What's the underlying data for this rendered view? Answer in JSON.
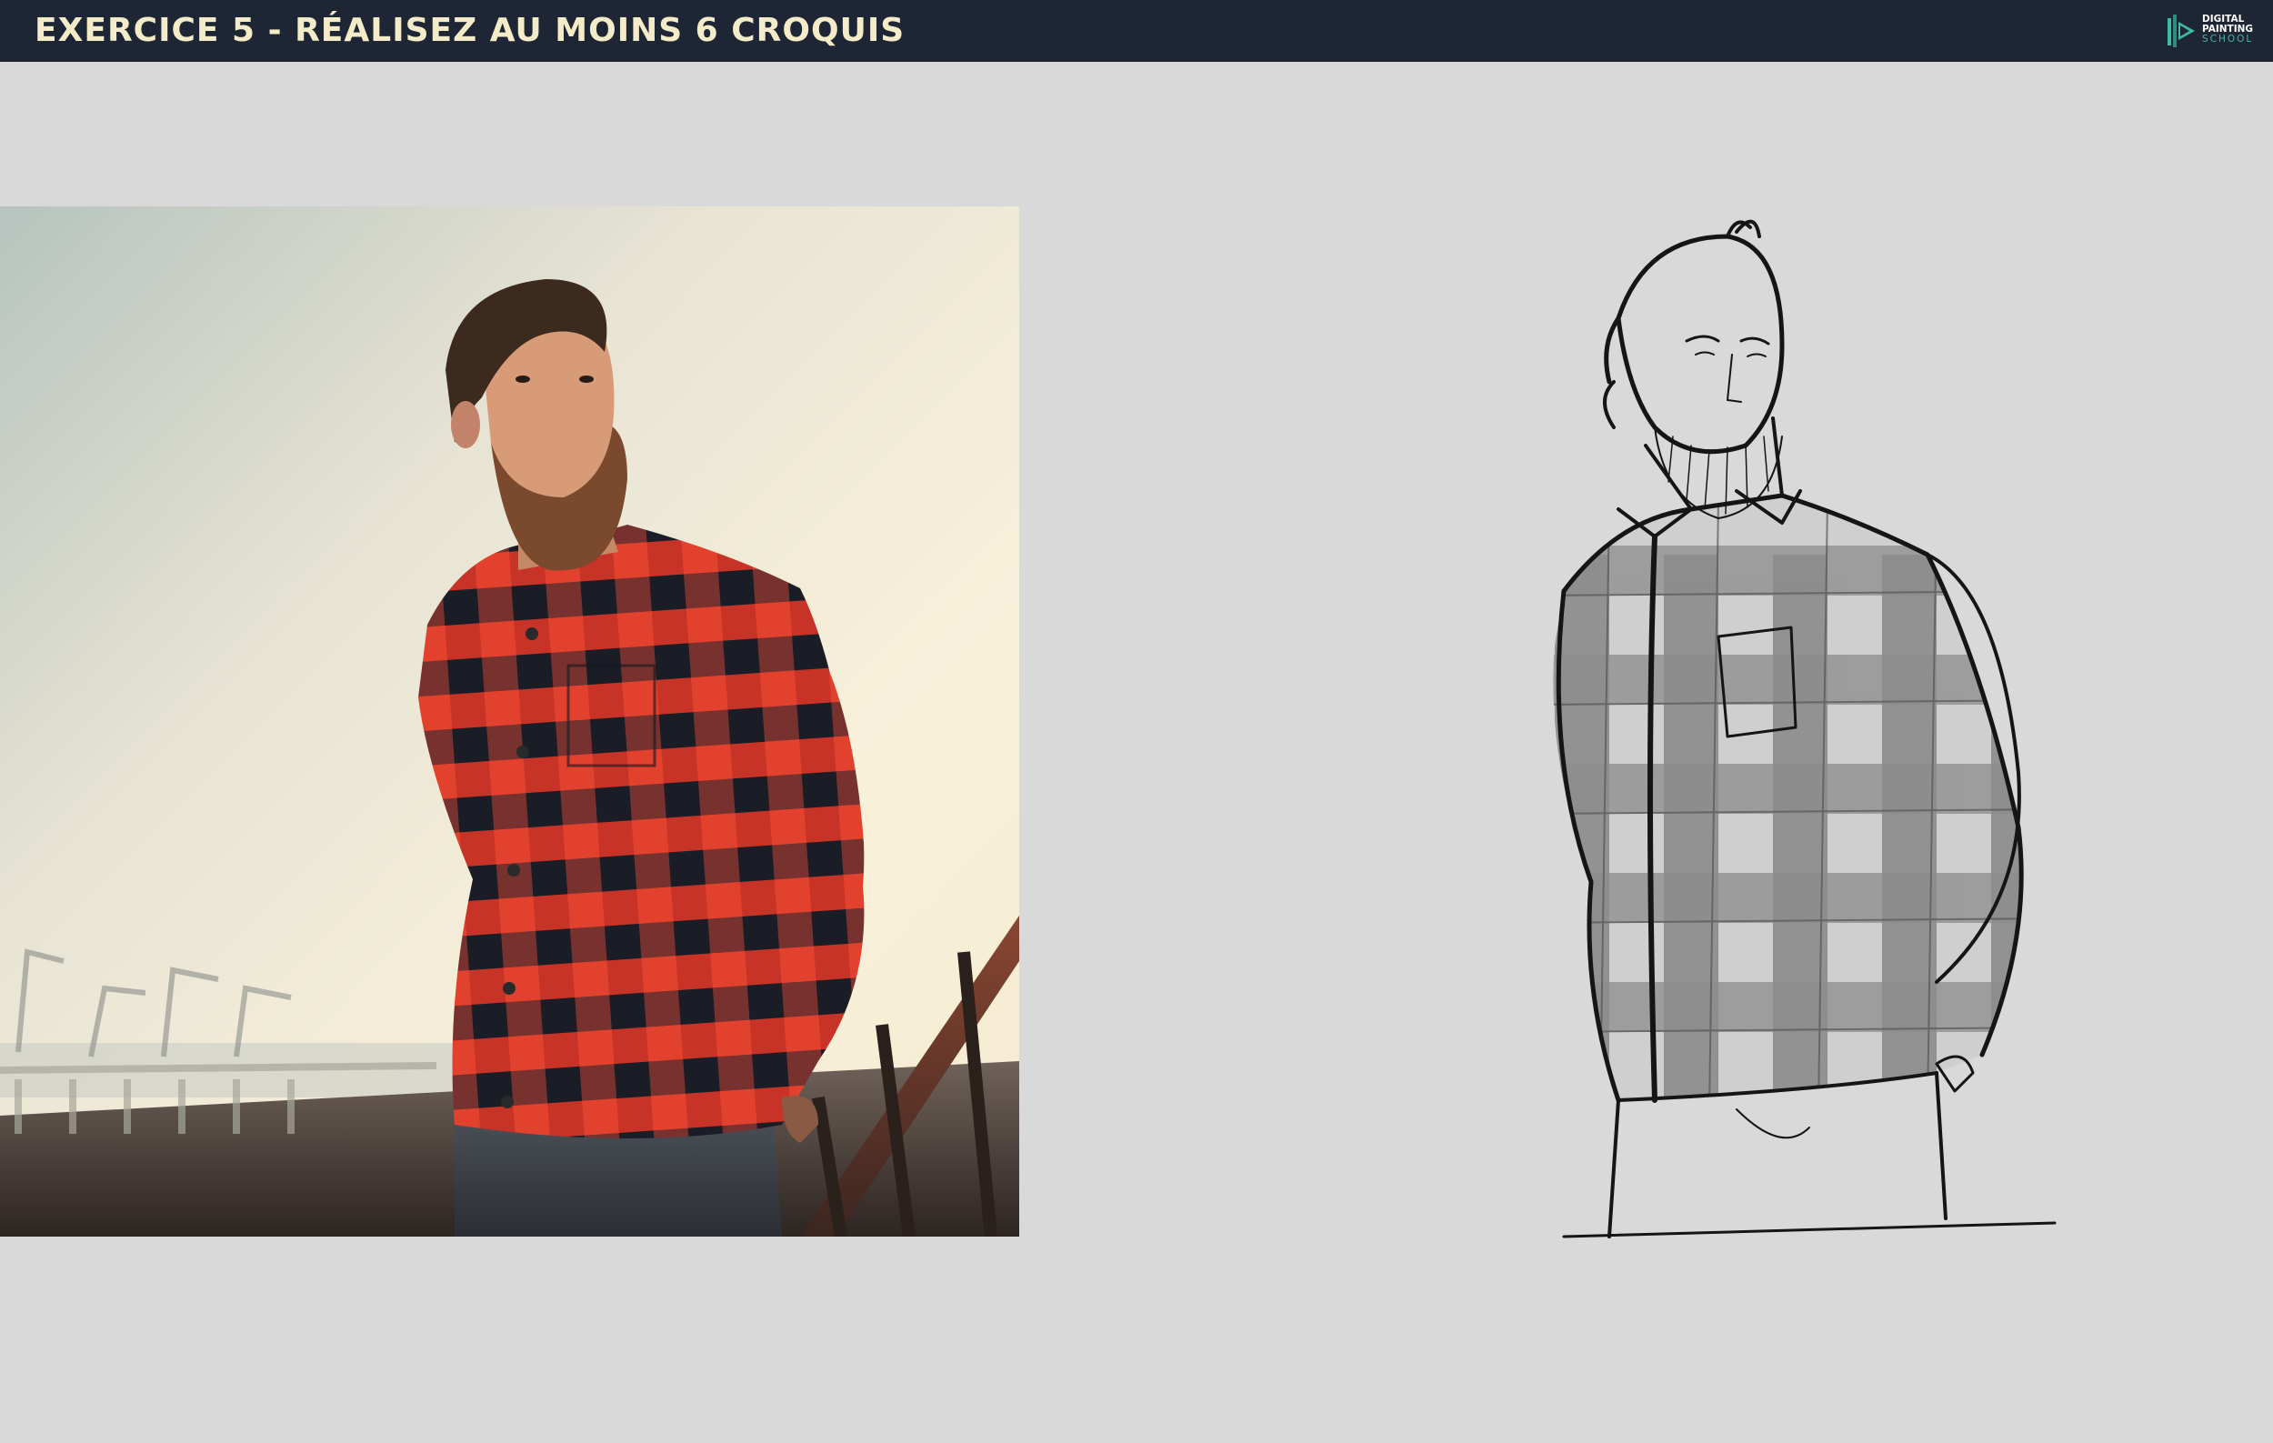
{
  "header": {
    "title": "EXERCICE 5 - RÉALISEZ AU MOINS 6 CROQUIS",
    "background": "#1e2535",
    "title_color": "#f4ecc8"
  },
  "logo": {
    "line1": "DIGITAL",
    "line2": "PAINTING",
    "line3": "SCHOOL",
    "accent": "#3fb9a6"
  },
  "content": {
    "background": "#d9d9d9",
    "reference_photo": {
      "icon": "bearded-man-plaid-shirt-photo"
    },
    "sketch": {
      "icon": "bearded-man-plaid-shirt-line-sketch"
    }
  }
}
